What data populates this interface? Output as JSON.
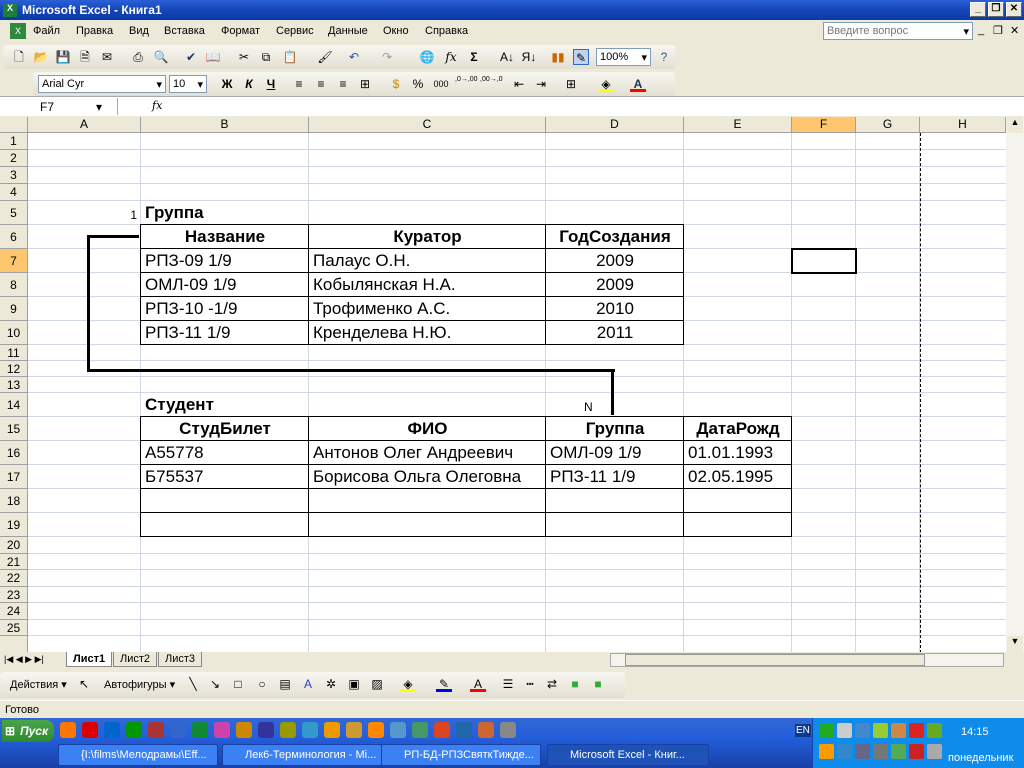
{
  "window": {
    "title": "Microsoft Excel - Книга1",
    "help_placeholder": "Введите вопрос"
  },
  "menu": [
    "Файл",
    "Правка",
    "Вид",
    "Вставка",
    "Формат",
    "Сервис",
    "Данные",
    "Окно",
    "Справка"
  ],
  "toolbar": {
    "zoom": "100%",
    "font": "Arial Cyr",
    "size": "10",
    "bold": "Ж",
    "italic": "К",
    "underline": "Ч",
    "percent": "%",
    "thousands": "000",
    "inc_dec": ",0→,00",
    "dec_dec": ",00→,0"
  },
  "formula_bar": {
    "name_box": "F7",
    "fx": "fx",
    "value": ""
  },
  "columns": [
    "A",
    "B",
    "C",
    "D",
    "E",
    "F",
    "G",
    "H"
  ],
  "rows": [
    "1",
    "2",
    "3",
    "4",
    "5",
    "6",
    "7",
    "8",
    "9",
    "10",
    "11",
    "12",
    "13",
    "14",
    "15",
    "16",
    "17",
    "18",
    "19",
    "20",
    "21",
    "22",
    "23",
    "24",
    "25"
  ],
  "cells": {
    "A5": "1",
    "B5": "Группа",
    "B6": "Название",
    "C6": "Куратор",
    "D6": "ГодСоздания",
    "B7": "РПЗ-09 1/9",
    "C7": "Палаус О.Н.",
    "D7": "2009",
    "B8": "ОМЛ-09 1/9",
    "C8": "Кобылянская Н.А.",
    "D8": "2009",
    "B9": "РПЗ-10 -1/9",
    "C9": "Трофименко А.С.",
    "D9": "2010",
    "B10": "РПЗ-11 1/9",
    "C10": "Кренделева Н.Ю.",
    "D10": "2011",
    "B14": "Студент",
    "D14": "N",
    "B15": "СтудБилет",
    "C15": "ФИО",
    "D15": "Группа",
    "E15": "ДатаРожд",
    "B16": "А55778",
    "C16": "Антонов Олег Андреевич",
    "D16": "ОМЛ-09 1/9",
    "E16": "01.01.1993",
    "B17": "Б75537",
    "C17": "Борисова Ольга Олеговна",
    "D17": "РПЗ-11 1/9",
    "E17": "02.05.1995"
  },
  "sheets": [
    "Лист1",
    "Лист2",
    "Лист3"
  ],
  "drawing": {
    "actions": "Действия",
    "autoshapes": "Автофигуры"
  },
  "status": "Готово",
  "taskbar": {
    "start": "Пуск",
    "tasks": [
      "{I:\\films\\Мелодрамы\\Eff...",
      "Лек6-Терминология - Mi...",
      "РП-БД-РПЗСвяткТижде...",
      "Microsoft Excel - Книг..."
    ],
    "lang": "EN",
    "time": "14:15",
    "day": "понедельник"
  }
}
